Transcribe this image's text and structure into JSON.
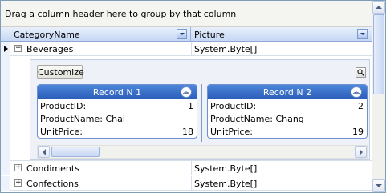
{
  "group_panel": {
    "text": "Drag a column header here to group by that column"
  },
  "columns": [
    {
      "label": "CategoryName"
    },
    {
      "label": "Picture"
    }
  ],
  "rows": [
    {
      "category": "Beverages",
      "picture": "System.Byte[]",
      "expanded": true,
      "expander": "−"
    },
    {
      "category": "Condiments",
      "picture": "System.Byte[]",
      "expanded": false,
      "expander": "+"
    },
    {
      "category": "Confections",
      "picture": "System.Byte[]",
      "expanded": false,
      "expander": "+"
    }
  ],
  "detail": {
    "customize_label": "Customize",
    "records": [
      {
        "title": "Record N 1",
        "fields": [
          {
            "label": "ProductID:",
            "value": "1"
          },
          {
            "label": "ProductName:",
            "value": "Chai"
          },
          {
            "label": "UnitPrice:",
            "value": "18"
          }
        ]
      },
      {
        "title": "Record N 2",
        "fields": [
          {
            "label": "ProductID:",
            "value": "2"
          },
          {
            "label": "ProductName:",
            "value": "Chang"
          },
          {
            "label": "UnitPrice:",
            "value": "19"
          }
        ]
      }
    ]
  },
  "colors": {
    "record_header_active": "#2a5db8",
    "grid_header": "#c6d8f4"
  }
}
